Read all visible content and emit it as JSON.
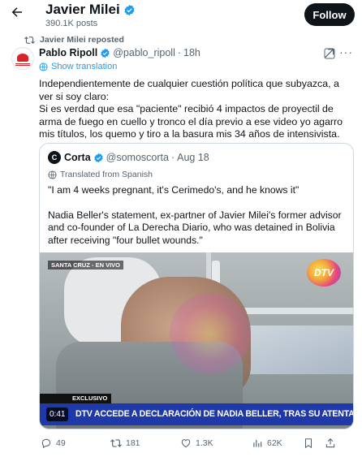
{
  "header": {
    "back_icon": "arrow-left-icon",
    "name": "Javier Milei",
    "posts": "390.1K posts",
    "follow_label": "Follow"
  },
  "repost": {
    "label": "Javier Milei reposted"
  },
  "tweet": {
    "author": "Pablo Ripoll",
    "handle": "@pablo_ripoll",
    "dot": "·",
    "time": "18h",
    "show_translation": "Show translation",
    "lines": [
      "Independientemente de cualquier cuestión política que subyazca, a ver si soy claro:",
      "Si es verdad que esa \"paciente\" recibió 4 impactos de proyectil de arma de fuego en cuello y tronco el día previo a ese video yo agarro mis títulos, los quemo y tiro a la basura mis 34 años de intensivista."
    ]
  },
  "quote": {
    "avatar_letter": "C",
    "author": "Corta",
    "handle": "@somoscorta",
    "dot": "·",
    "time": "Aug 18",
    "translated": "Translated from Spanish",
    "paragraphs": [
      "\"I am 4 weeks pregnant, it's Cerimedo's, and he knows it\"",
      "Nadia Beller's statement, ex-partner of Javier Milei's former advisor and co-founder of La Derecha Diario, who was detained in Bolivia after receiving \"four bullet wounds.\""
    ],
    "video": {
      "location": "SANTA CRUZ - EN VIVO",
      "logo": "DTV",
      "exclusivo": "EXCLUSIVO",
      "banner": "DTV ACCEDE A DECLARACIÓN DE NADIA BELLER, TRAS SU ATENTADO",
      "timestamp": "0:41"
    }
  },
  "actions": {
    "replies": "49",
    "reposts": "181",
    "likes": "1.3K",
    "views": "62K"
  },
  "colors": {
    "text": "#0f1419",
    "muted": "#536471",
    "link": "#1d9bf0",
    "verified": "#1d9bf0",
    "banner": "#1f3aa8"
  }
}
